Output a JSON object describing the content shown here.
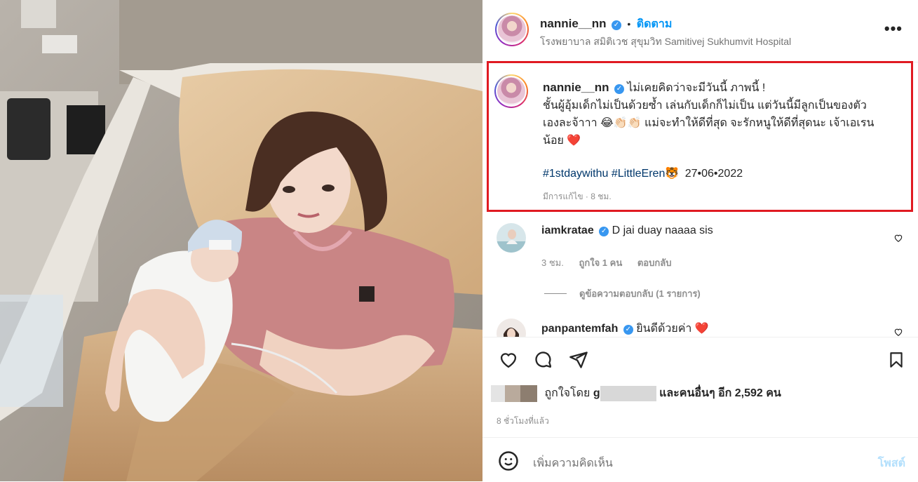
{
  "post_header": {
    "username": "nannie__nn",
    "separator": "•",
    "follow_label": "ติดตาม",
    "location": "โรงพยาบาล สมิติเวช สุขุมวิท Samitivej Sukhumvit Hospital",
    "more_icon": "more-horizontal-icon"
  },
  "caption": {
    "username": "nannie__nn",
    "line1": "ไม่เคยคิดว่าจะมีวันนี้ ภาพนี้ !",
    "line2": "ชั้นผู้อุ้มเด็กไม่เป็นด้วยซ้ำ เล่นกับเด็กก็ไม่เป็น แต่วันนี้มีลูกเป็นของตัว",
    "line3": "เองละจ้าาา 😂👏🏻👏🏻 แม่จะทำให้ดีที่สุด จะรักหนูให้ดีที่สุดนะ เจ้าเอเรน",
    "line4": "น้อย ❤️",
    "hashtag1": "#1stdaywithu",
    "hashtag2": "#LittleEren",
    "tiger": "🐯",
    "date": "27•06•2022",
    "edited": "มีการแก้ไข · 8 ชม.",
    "highlight_color": "#e01a22"
  },
  "comments": [
    {
      "username": "iamkratae",
      "text": "D jai duay naaaa sis",
      "time": "3 ชม.",
      "likes": "ถูกใจ 1 คน",
      "reply": "ตอบกลับ",
      "view_replies": "ดูข้อความตอบกลับ (1 รายการ)"
    },
    {
      "username": "panpantemfah",
      "text": "ยินดีด้วยค่า ❤️"
    }
  ],
  "likes": {
    "prefix": "ถูกใจโดย",
    "first_initial": "g",
    "suffix": "และคนอื่นๆ อีก 2,592 คน"
  },
  "time_ago": "8 ชั่วโมงที่แล้ว",
  "add_comment": {
    "placeholder": "เพิ่มความคิดเห็น",
    "post_label": "โพสต์"
  },
  "colors": {
    "follow": "#0095f6",
    "verified": "#3897f0",
    "hashtag": "#00376b",
    "highlight": "#e01a22"
  }
}
